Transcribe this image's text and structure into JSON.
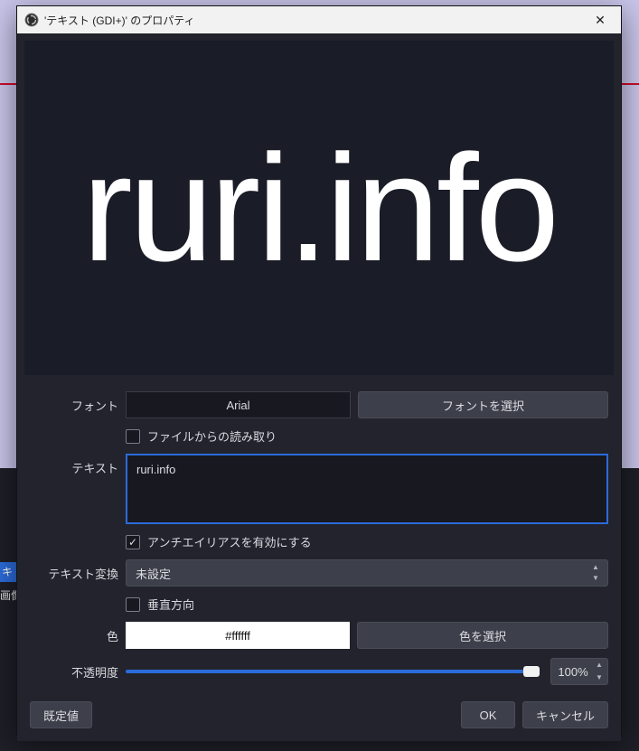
{
  "window": {
    "title": "'テキスト (GDI+)' のプロパティ"
  },
  "preview": {
    "text": "ruri.info"
  },
  "form": {
    "font": {
      "label": "フォント",
      "value": "Arial",
      "choose_button": "フォントを選択"
    },
    "read_from_file": {
      "label": "ファイルからの読み取り",
      "checked": false
    },
    "text": {
      "label": "テキスト",
      "value": "ruri.info"
    },
    "antialias": {
      "label": "アンチエイリアスを有効にする",
      "checked": true
    },
    "transform": {
      "label": "テキスト変換",
      "value": "未設定"
    },
    "vertical": {
      "label": "垂直方向",
      "checked": false
    },
    "color": {
      "label": "色",
      "value": "#ffffff",
      "choose_button": "色を選択"
    },
    "opacity": {
      "label": "不透明度",
      "value": "100%"
    }
  },
  "footer": {
    "defaults": "既定値",
    "ok": "OK",
    "cancel": "キャンセル"
  },
  "background": {
    "strip_blue": "キ",
    "strip_label": "画像"
  }
}
